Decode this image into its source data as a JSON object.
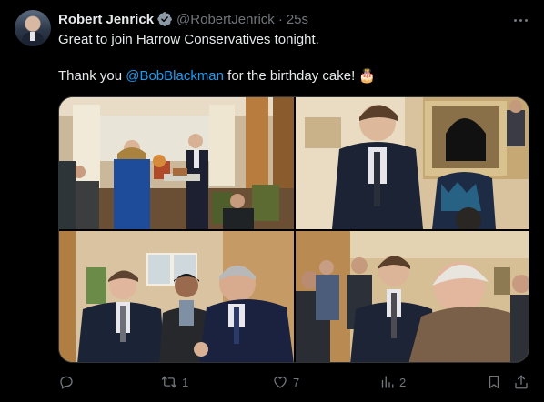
{
  "tweet": {
    "author_name": "Robert Jenrick",
    "handle": "@RobertJenrick",
    "separator": "·",
    "time": "25s",
    "line1": "Great to join Harrow Conservatives tonight.",
    "line2_before": "Thank you ",
    "mention": "@BobBlackman",
    "line2_after": " for the birthday cake! 🎂",
    "verified_color": "#8b98a5",
    "mention_color": "#1d9bf0"
  },
  "photos": [
    {
      "name": "photo-cake-presentation"
    },
    {
      "name": "photo-conversation-smiling"
    },
    {
      "name": "photo-group-chat"
    },
    {
      "name": "photo-elderly-guest"
    }
  ],
  "actions": {
    "reply": {
      "icon": "reply-icon",
      "count": ""
    },
    "repost": {
      "icon": "repost-icon",
      "count": "1"
    },
    "like": {
      "icon": "heart-icon",
      "count": "7"
    },
    "views": {
      "icon": "views-chart-icon",
      "count": "2"
    },
    "bookmark": {
      "icon": "bookmark-icon"
    },
    "share": {
      "icon": "share-icon"
    }
  }
}
